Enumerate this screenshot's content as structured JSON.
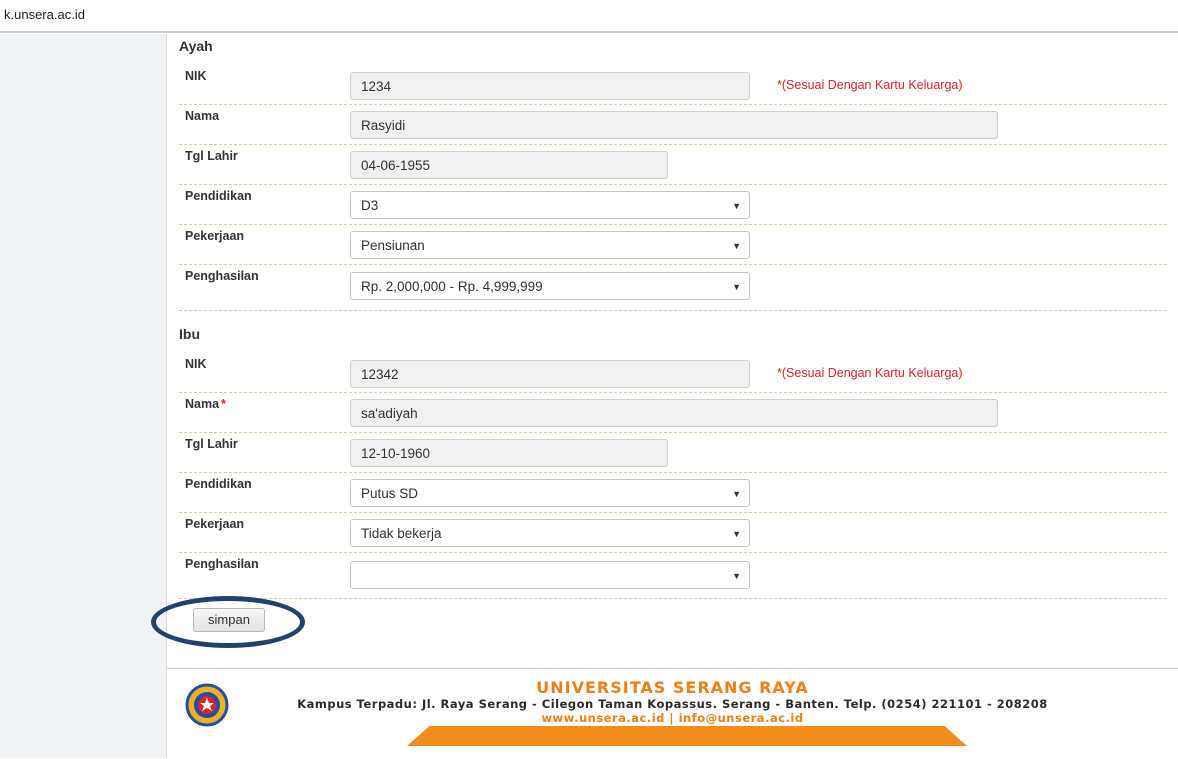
{
  "browser": {
    "url": "k.unsera.ac.id"
  },
  "form": {
    "note": "*(Sesuai Dengan Kartu Keluarga)",
    "ayah": {
      "title": "Ayah",
      "nik_label": "NIK",
      "nik_value": "1234",
      "nama_label": "Nama",
      "nama_value": "Rasyidi",
      "tgl_label": "Tgl Lahir",
      "tgl_value": "04-06-1955",
      "pendidikan_label": "Pendidikan",
      "pendidikan_value": "D3",
      "pekerjaan_label": "Pekerjaan",
      "pekerjaan_value": "Pensiunan",
      "penghasilan_label": "Penghasilan",
      "penghasilan_value": "Rp. 2,000,000 - Rp. 4,999,999"
    },
    "ibu": {
      "title": "Ibu",
      "nik_label": "NIK",
      "nik_value": "12342",
      "nama_label": "Nama",
      "nama_required": "*",
      "nama_value": "sa'adiyah",
      "tgl_label": "Tgl Lahir",
      "tgl_value": "12-10-1960",
      "pendidikan_label": "Pendidikan",
      "pendidikan_value": "Putus SD",
      "pekerjaan_label": "Pekerjaan",
      "pekerjaan_value": "Tidak bekerja",
      "penghasilan_label": "Penghasilan",
      "penghasilan_value": ""
    },
    "submit_label": "simpan"
  },
  "footer": {
    "name": "UNIVERSITAS SERANG RAYA",
    "address": "Kampus Terpadu: Jl. Raya Serang - Cilegon Taman Kopassus. Serang - Banten. Telp. (0254) 221101 - 208208",
    "web": "www.unsera.ac.id | info@unsera.ac.id",
    "logo_icon": "university-seal-icon"
  },
  "colors": {
    "accent_orange": "#f07f14",
    "required_red": "#e02424",
    "highlight_circle": "#23406f"
  }
}
